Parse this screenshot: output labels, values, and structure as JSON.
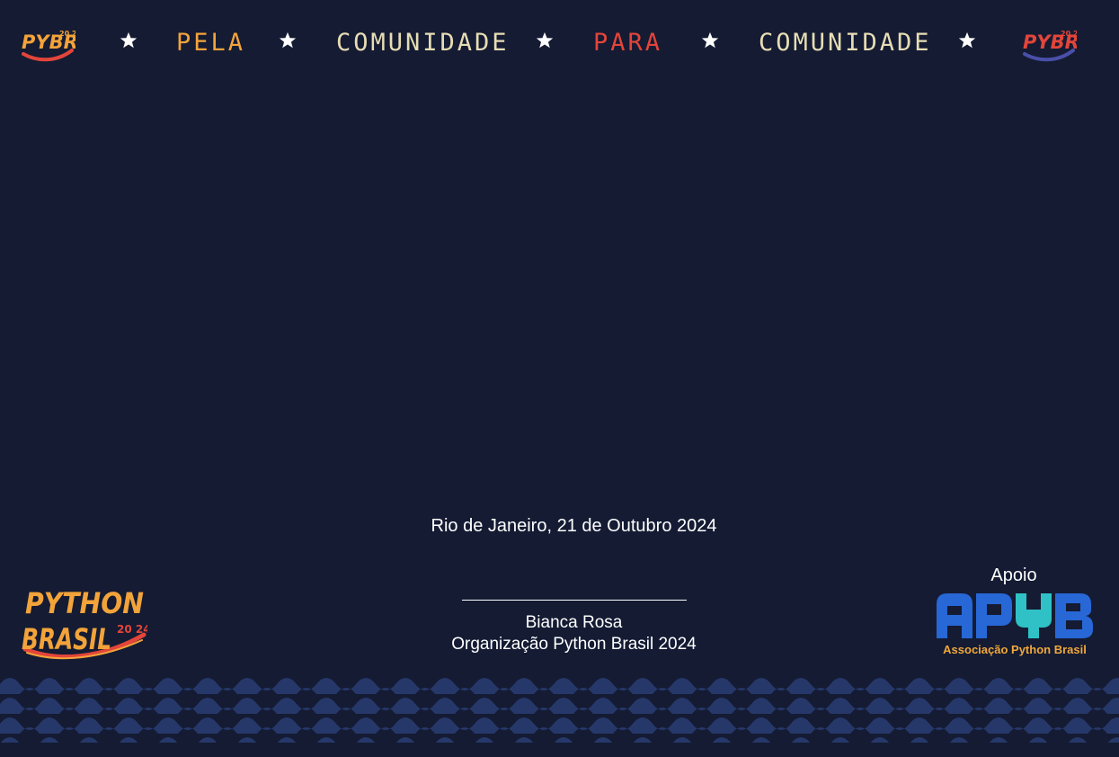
{
  "banner": {
    "words": [
      "PELA",
      "COMUNIDADE",
      "PARA",
      "COMUNIDADE"
    ],
    "logo_text": "PYBR",
    "logo_year": "20 24"
  },
  "certificate": {
    "place_date": "Rio de Janeiro, 21 de Outubro 2024",
    "signer_name": "Bianca Rosa",
    "signer_role": "Organização Python Brasil 2024"
  },
  "event_logo": {
    "line1": "PYTHON",
    "line2": "BRASIL",
    "year": "20 24"
  },
  "support": {
    "label": "Apoio",
    "org_acronym": "APYB",
    "org_name": "Associação Python Brasil"
  },
  "colors": {
    "background": "#141b33",
    "cream": "#e7ddb4",
    "orange": "#f2a33a",
    "red": "#e3453a",
    "apyb_blue": "#2867d6",
    "apyb_teal": "#2fc1c6",
    "apyb_text": "#f0a83a",
    "wave": "#26386a"
  },
  "icons": [
    "star-icon",
    "pybr-logo",
    "python-brasil-logo",
    "apyb-logo"
  ]
}
